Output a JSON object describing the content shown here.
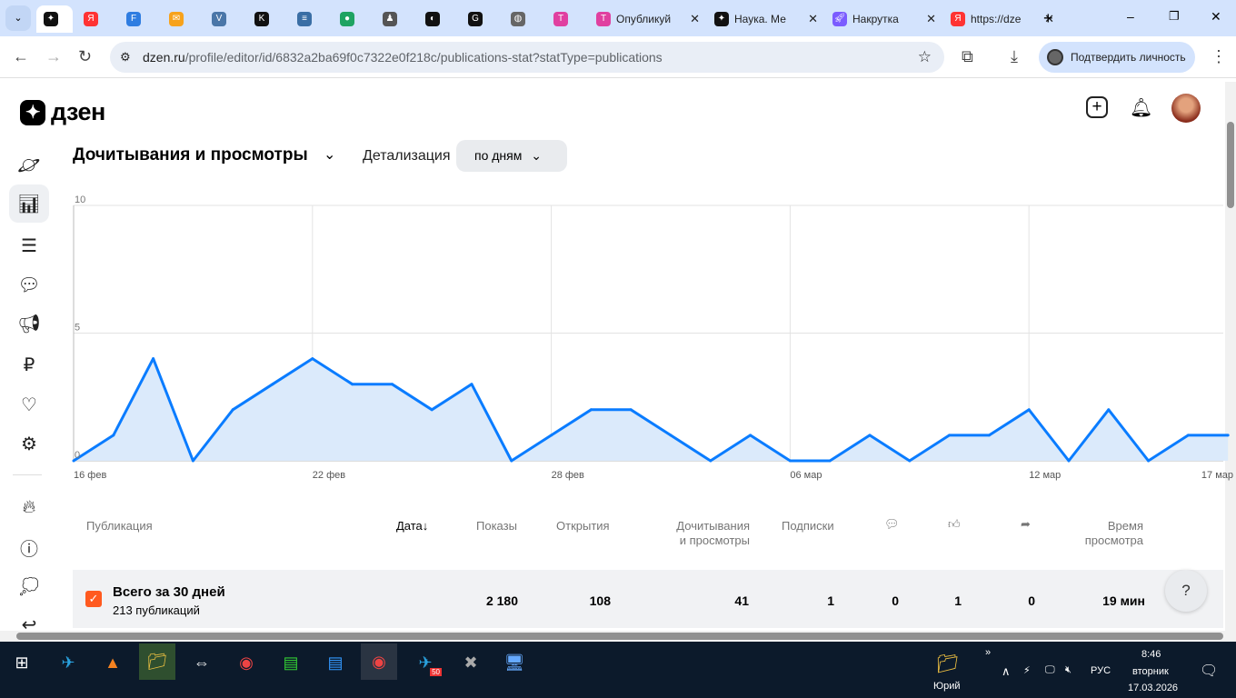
{
  "browser": {
    "tabs": [
      {
        "label": "",
        "icon": "dzen-icon"
      },
      {
        "label": "",
        "icon": "yandex-icon"
      },
      {
        "label": "",
        "icon": "f-icon"
      },
      {
        "label": "",
        "icon": "mail-icon"
      },
      {
        "label": "",
        "icon": "vk-icon"
      },
      {
        "label": "",
        "icon": "k-icon"
      },
      {
        "label": "",
        "icon": "server-icon"
      },
      {
        "label": "",
        "icon": "apps-icon"
      },
      {
        "label": "",
        "icon": "figure-icon"
      },
      {
        "label": "",
        "icon": "chatgpt-icon"
      },
      {
        "label": "",
        "icon": "gpt-icon"
      },
      {
        "label": "",
        "icon": "globe-icon"
      },
      {
        "label": "",
        "icon": "t-icon"
      },
      {
        "label": "Опубликуй",
        "icon": "t-icon"
      },
      {
        "label": "Наука. Ме",
        "icon": "dzen-icon"
      },
      {
        "label": "Накрутка",
        "icon": "rocket-icon"
      },
      {
        "label": "https://dze",
        "icon": "yandex-icon"
      }
    ],
    "url_host": "dzen.ru",
    "url_path": "/profile/editor/id/6832a2ba69f0c7322e0f218c/publications-stat?statType=publications",
    "verify_label": "Подтвердить личность"
  },
  "page": {
    "logo": "дзен",
    "title": "Дочитывания и просмотры",
    "detail_label": "Детализация",
    "detail_value": "по дням"
  },
  "chart_data": {
    "type": "area",
    "series": [
      {
        "name": "Дочитывания и просмотры",
        "values": [
          0,
          1,
          4,
          0,
          2,
          3,
          4,
          3,
          3,
          2,
          3,
          0,
          1,
          2,
          2,
          1,
          0,
          1,
          0,
          0,
          1,
          0,
          1,
          1,
          2,
          0,
          2,
          0,
          1,
          1
        ]
      }
    ],
    "x_start": "16 фев",
    "x_end": "17 мар",
    "x_tick_labels": [
      "16 фев",
      "22 фев",
      "28 фев",
      "06 мар",
      "12 мар",
      "17 ма"
    ],
    "y_tick_labels": [
      "0",
      "5",
      "10"
    ],
    "ylim": [
      0,
      10
    ],
    "grid": true,
    "line_color": "#0a7cff",
    "fill_color": "#dbeafb"
  },
  "table": {
    "headers": {
      "pub": "Публикация",
      "date": "Дата↓",
      "shows": "Показы",
      "opens": "Открытия",
      "reads": "Дочитывания\nи просмотры",
      "subs": "Подписки",
      "time": "Время\nпросмотра"
    },
    "total": {
      "title": "Всего за 30 дней",
      "sub": "213 публикаций",
      "shows": "2 180",
      "opens": "108",
      "reads": "41",
      "subs": "1",
      "comments": "0",
      "likes": "1",
      "shares": "0",
      "time": "19 мин"
    },
    "help": "?"
  },
  "taskbar": {
    "user": "Юрий",
    "lang": "РУС",
    "time": "8:46",
    "day": "вторник",
    "date": "17.03.2026",
    "badge": "50"
  }
}
